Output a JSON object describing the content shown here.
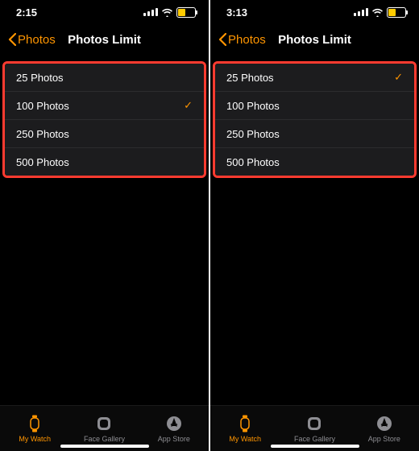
{
  "screens": [
    {
      "time": "2:15",
      "back_label": "Photos",
      "title": "Photos Limit",
      "options": [
        {
          "label": "25 Photos",
          "selected": false
        },
        {
          "label": "100 Photos",
          "selected": true
        },
        {
          "label": "250 Photos",
          "selected": false
        },
        {
          "label": "500 Photos",
          "selected": false
        }
      ]
    },
    {
      "time": "3:13",
      "back_label": "Photos",
      "title": "Photos Limit",
      "options": [
        {
          "label": "25 Photos",
          "selected": true
        },
        {
          "label": "100 Photos",
          "selected": false
        },
        {
          "label": "250 Photos",
          "selected": false
        },
        {
          "label": "500 Photos",
          "selected": false
        }
      ]
    }
  ],
  "tabs": [
    {
      "label": "My Watch",
      "icon": "watch",
      "active": true
    },
    {
      "label": "Face Gallery",
      "icon": "face",
      "active": false
    },
    {
      "label": "App Store",
      "icon": "appstore",
      "active": false
    }
  ],
  "battery_level": "40%"
}
